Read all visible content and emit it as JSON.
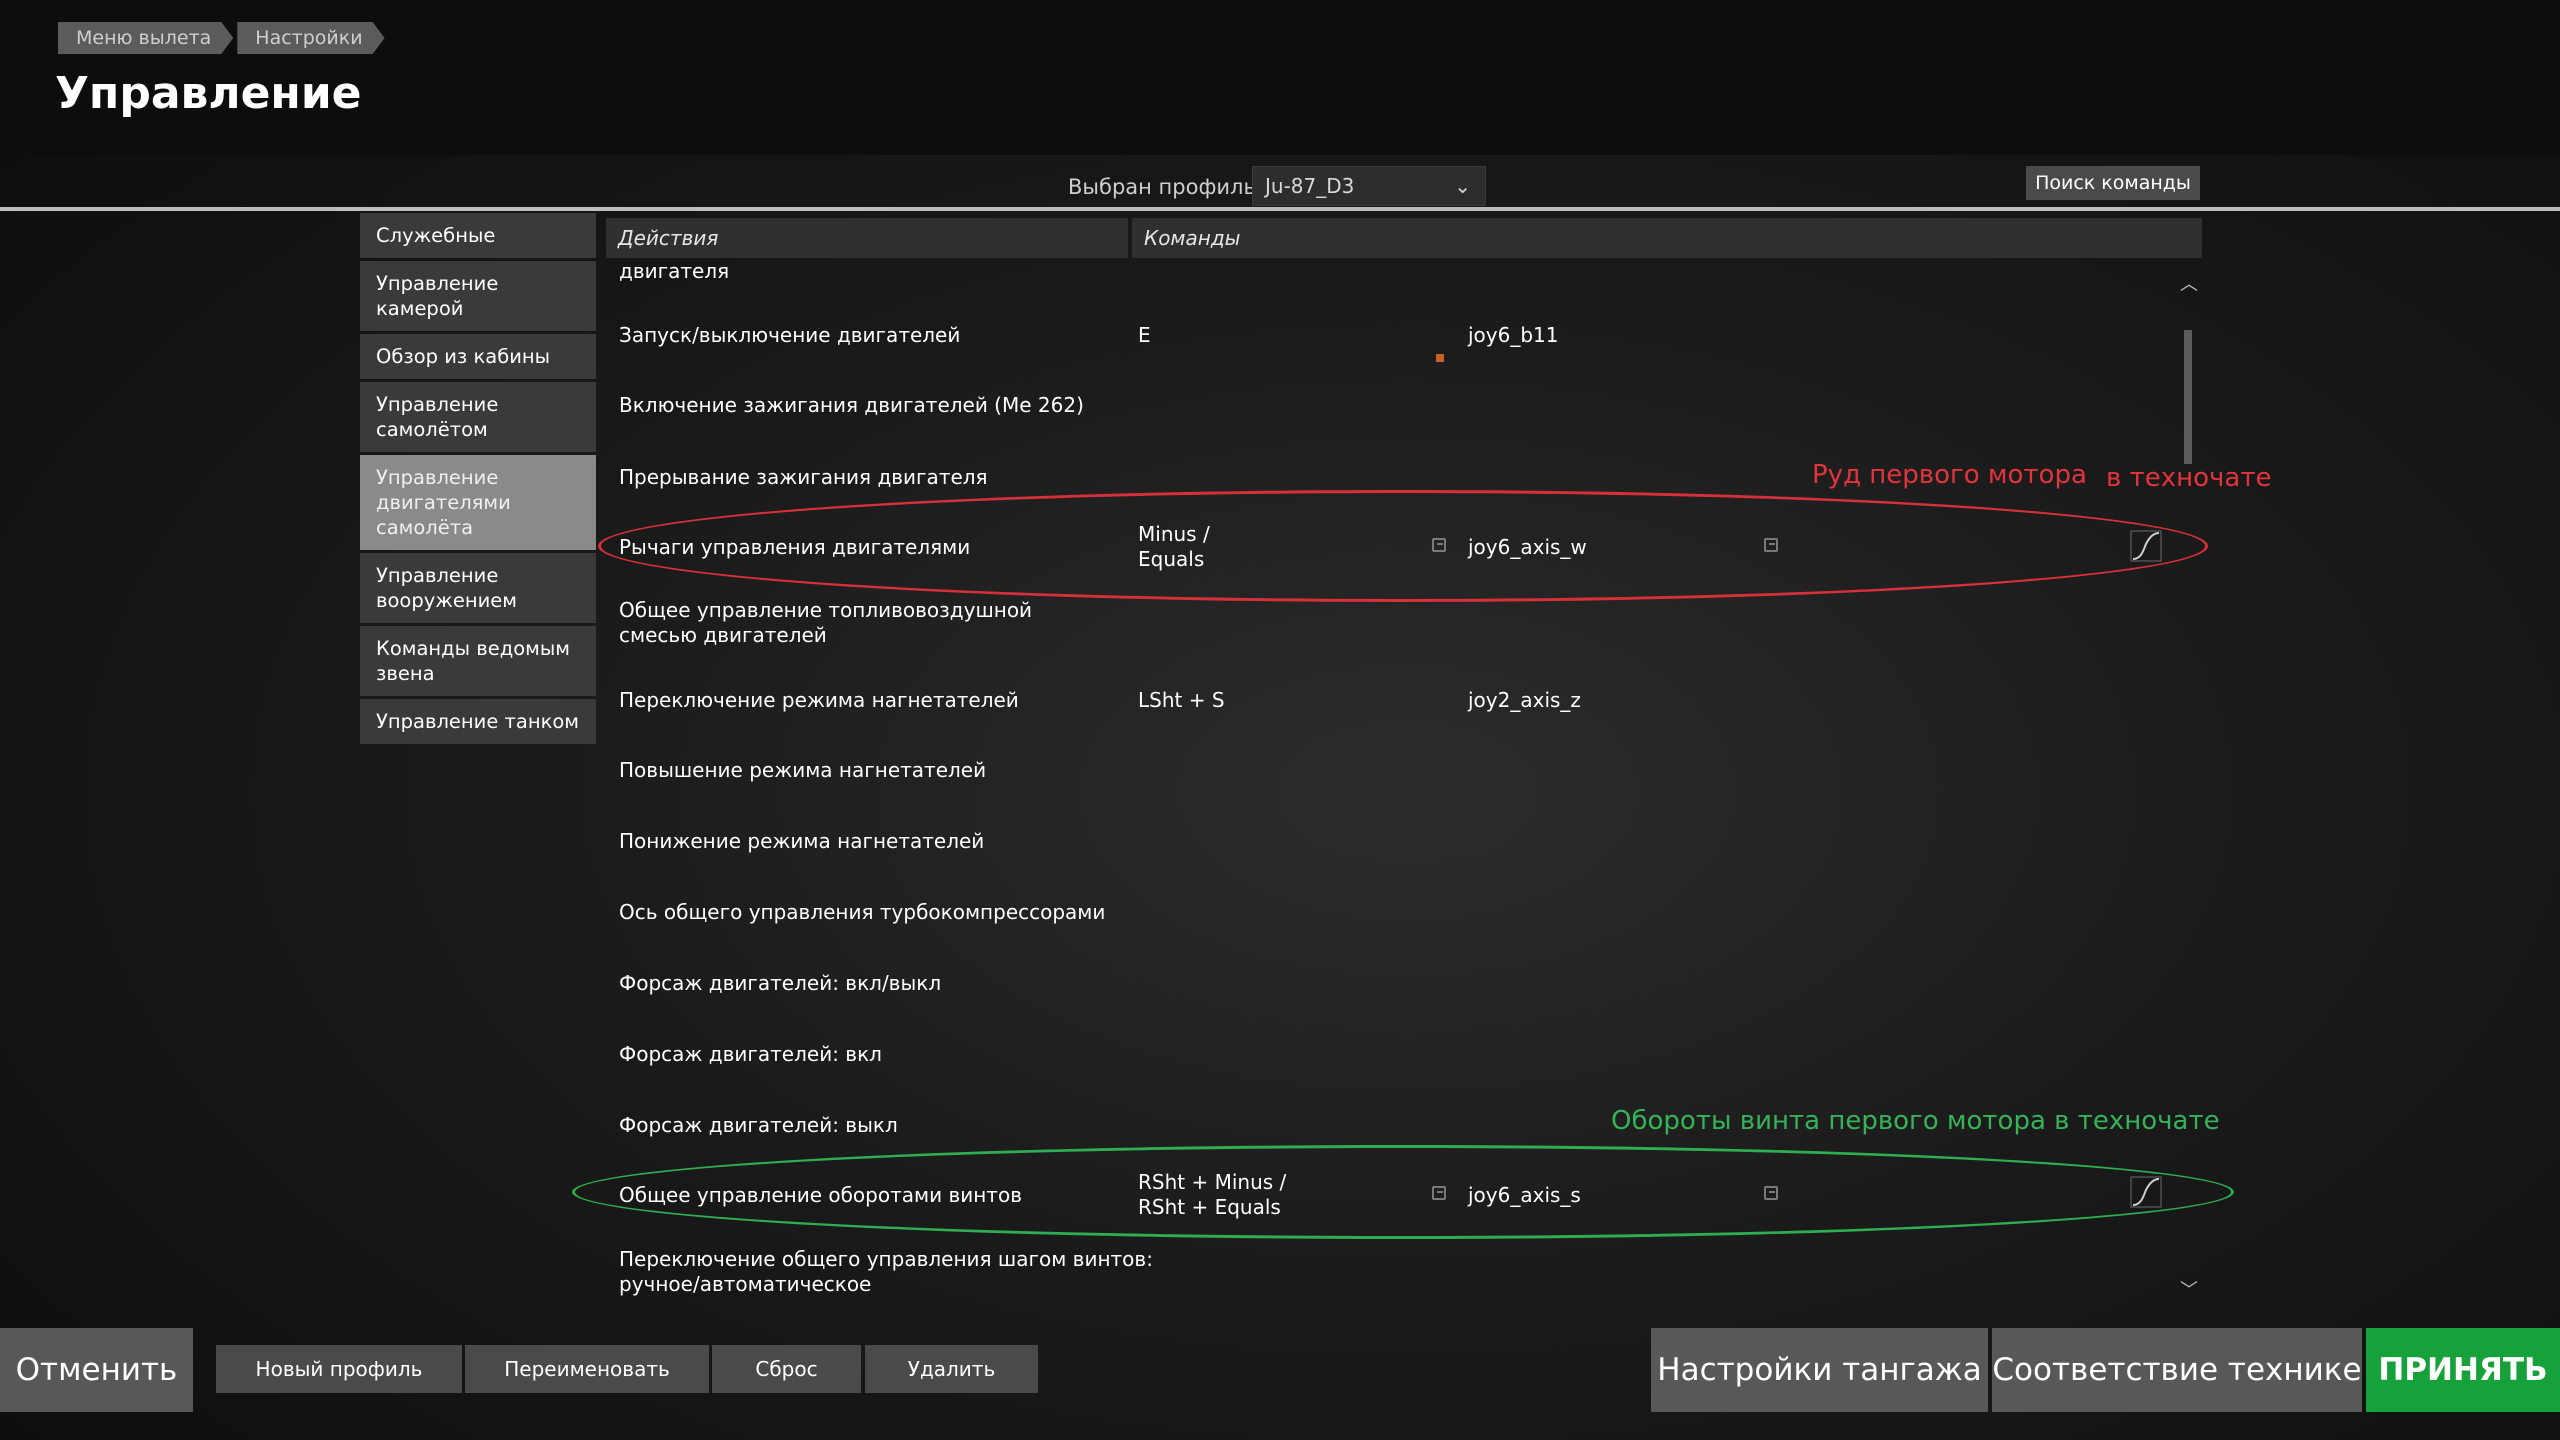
{
  "breadcrumb": [
    "Меню вылета",
    "Настройки"
  ],
  "page_title": "Управление",
  "profile": {
    "label": "Выбран профиль",
    "value": "Ju-87_D3"
  },
  "search_command": "Поиск команды",
  "sidebar": {
    "items": [
      "Служебные",
      "Управление камерой",
      "Обзор из кабины",
      "Управление самолётом",
      "Управление двигателями самолёта",
      "Управление вооружением",
      "Команды ведомым звена",
      "Управление танком"
    ],
    "active_index": 4
  },
  "table": {
    "header_actions": "Действия",
    "header_commands": "Команды",
    "partial_top_row": "двигателя",
    "rows": [
      {
        "action": "Запуск/выключение двигателей",
        "key": "E",
        "joy": "joy6_b11"
      },
      {
        "action": "Включение зажигания двигателей (Me 262)",
        "key": "",
        "joy": ""
      },
      {
        "action": "Прерывание зажигания двигателя",
        "key": "",
        "joy": ""
      },
      {
        "action": "Рычаги управления двигателями",
        "key": "Minus / Equals",
        "joy": "joy6_axis_w"
      },
      {
        "action": "Общее управление топливовоздушной смесью двигателей",
        "key": "",
        "joy": ""
      },
      {
        "action": "Переключение режима нагнетателей",
        "key": "LSht + S",
        "joy": "joy2_axis_z"
      },
      {
        "action": "Повышение режима нагнетателей",
        "key": "",
        "joy": ""
      },
      {
        "action": "Понижение режима нагнетателей",
        "key": "",
        "joy": ""
      },
      {
        "action": "Ось общего управления турбокомпрессорами",
        "key": "",
        "joy": ""
      },
      {
        "action": "Форсаж двигателей: вкл/выкл",
        "key": "",
        "joy": ""
      },
      {
        "action": "Форсаж двигателей: вкл",
        "key": "",
        "joy": ""
      },
      {
        "action": "Форсаж двигателей: выкл",
        "key": "",
        "joy": ""
      },
      {
        "action": "Общее управление оборотами винтов",
        "key": "RSht + Minus / RSht + Equals",
        "joy": "joy6_axis_s"
      },
      {
        "action": "Переключение общего управления шагом винтов: ручное/автоматическое",
        "key": "",
        "joy": ""
      }
    ]
  },
  "annotations": {
    "red_note_1": "Руд первого мотора",
    "red_note_2": "в техночате",
    "green_note": "Обороты винта первого мотора в техночате",
    "red_color": "#d8303a",
    "green_color": "#2fae51"
  },
  "bottom": {
    "cancel": "Отменить",
    "new_profile": "Новый профиль",
    "rename": "Переименовать",
    "reset": "Сброс",
    "delete": "Удалить",
    "pitch_settings": "Настройки тангажа",
    "vehicle_match": "Соответствие технике",
    "accept": "ПРИНЯТЬ",
    "accept_color": "#16a13a"
  }
}
